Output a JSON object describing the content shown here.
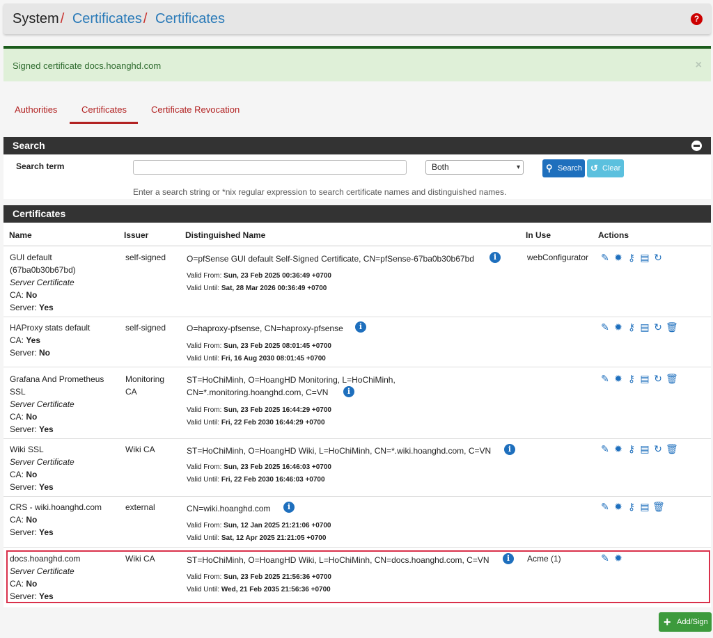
{
  "breadcrumb": [
    "System",
    "Certificates",
    "Certificates"
  ],
  "alert": {
    "message": "Signed certificate docs.hoanghd.com",
    "close": "×"
  },
  "tabs": [
    "Authorities",
    "Certificates",
    "Certificate Revocation"
  ],
  "search": {
    "title": "Search",
    "label": "Search term",
    "value": "",
    "select": "Both",
    "search_btn": "Search",
    "clear_btn": "Clear",
    "hint": "Enter a search string or *nix regular expression to search certificate names and distinguished names."
  },
  "certificates": {
    "title": "Certificates",
    "headers": {
      "name": "Name",
      "issuer": "Issuer",
      "dn": "Distinguished Name",
      "inuse": "In Use",
      "actions": "Actions"
    },
    "rows": [
      {
        "name": "GUI default (67ba0b30b67bd)",
        "type": "Server Certificate",
        "ca": "No",
        "server": "Yes",
        "issuer": "self-signed",
        "dn": "O=pfSense GUI default Self-Signed Certificate, CN=pfSense-67ba0b30b67bd",
        "from": "Sun, 23 Feb 2025 00:36:49 +0700",
        "until": "Sat, 28 Mar 2026 00:36:49 +0700",
        "inuse": "webConfigurator"
      },
      {
        "name": "HAProxy stats default",
        "type": "",
        "ca": "Yes",
        "server": "No",
        "issuer": "self-signed",
        "dn": "O=haproxy-pfsense, CN=haproxy-pfsense",
        "from": "Sun, 23 Feb 2025 08:01:45 +0700",
        "until": "Fri, 16 Aug 2030 08:01:45 +0700",
        "inuse": ""
      },
      {
        "name": "Grafana And Prometheus SSL",
        "type": "Server Certificate",
        "ca": "No",
        "server": "Yes",
        "issuer": "Monitoring CA",
        "dn": "ST=HoChiMinh, O=HoangHD Monitoring, L=HoChiMinh, CN=*.monitoring.hoanghd.com, C=VN",
        "from": "Sun, 23 Feb 2025 16:44:29 +0700",
        "until": "Fri, 22 Feb 2030 16:44:29 +0700",
        "inuse": ""
      },
      {
        "name": "Wiki SSL",
        "type": "Server Certificate",
        "ca": "No",
        "server": "Yes",
        "issuer": "Wiki CA",
        "dn": "ST=HoChiMinh, O=HoangHD Wiki, L=HoChiMinh, CN=*.wiki.hoanghd.com, C=VN",
        "from": "Sun, 23 Feb 2025 16:46:03 +0700",
        "until": "Fri, 22 Feb 2030 16:46:03 +0700",
        "inuse": ""
      },
      {
        "name": "CRS - wiki.hoanghd.com",
        "type": "",
        "ca": "No",
        "server": "Yes",
        "issuer": "external",
        "dn": "CN=wiki.hoanghd.com",
        "from": "Sun, 12 Jan 2025 21:21:06 +0700",
        "until": "Sat, 12 Apr 2025 21:21:05 +0700",
        "inuse": ""
      },
      {
        "name": "docs.hoanghd.com",
        "type": "Server Certificate",
        "ca": "No",
        "server": "Yes",
        "issuer": "Wiki CA",
        "dn": "ST=HoChiMinh, O=HoangHD Wiki, L=HoChiMinh, CN=docs.hoanghd.com, C=VN",
        "from": "Sun, 23 Feb 2025 21:56:36 +0700",
        "until": "Wed, 21 Feb 2035 21:56:36 +0700",
        "inuse": "Acme (1)"
      }
    ],
    "labels": {
      "ca": "CA: ",
      "server": "Server: ",
      "from": "Valid From: ",
      "until": "Valid Until: "
    }
  },
  "add_button": "Add/Sign",
  "colors": {
    "accent": "#1e6fbd",
    "tab_red": "#b22222",
    "header_dark": "#333333",
    "success": "#3c9a3c",
    "highlight": "#d9304a"
  }
}
